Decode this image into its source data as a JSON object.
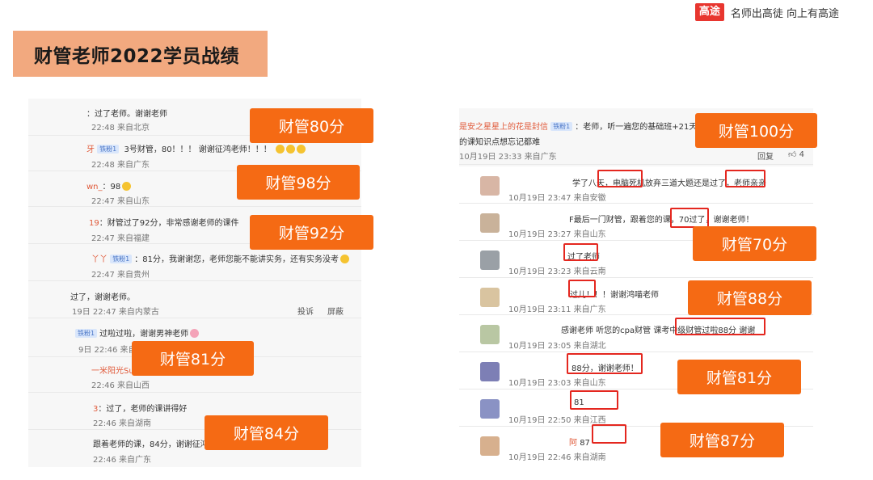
{
  "brand": {
    "logo": "高途",
    "slogan": "名师出高徒 向上有高途"
  },
  "title": "财管老师2022学员战绩",
  "left_comments": [
    {
      "text": "：过了老师。谢谢老师",
      "meta": "22:48 来自北京"
    },
    {
      "name": "牙",
      "badge": "铁粉1",
      "text": "3号财管，80！！！ 谢谢征鸿老师！！！",
      "meta": "22:48 来自广东"
    },
    {
      "name": "wn_",
      "text": "：98",
      "meta": "22:47 来自山东"
    },
    {
      "name": "19",
      "text": "：财管过了92分，非常感谢老师的课件",
      "meta": "22:47 来自福建"
    },
    {
      "name": "丫丫",
      "badge": "铁粉1",
      "text": "：81分，我谢谢您，老师您能不能讲实务，还有实务没考",
      "meta": "22:47 来自贵州"
    },
    {
      "text": "过了，谢谢老师。",
      "meta": "19日 22:47 来自内蒙古",
      "actions": [
        "投诉",
        "屏蔽"
      ]
    },
    {
      "badge": "铁粉1",
      "text": "过啦过啦，谢谢男神老师",
      "meta": "9日 22:46 来自四川"
    },
    {
      "name": "一米阳光Su",
      "text": "",
      "meta": "22:46 来自山西"
    },
    {
      "name": "3",
      "text": "：过了，老师的课讲得好",
      "meta": "22:46 来自湖南"
    },
    {
      "text": "跟着老师的课，84分，谢谢征鸿",
      "meta": "22:46 来自广东"
    }
  ],
  "right_top": {
    "name": "是安之星星上的花是封信",
    "badge": "铁粉1",
    "text": "：老师，听一遍您的基础班+21天",
    "text2": "的课知识点想忘记都难",
    "meta": "10月19日 23:33 来自广东",
    "reply": "回复",
    "likes": "4"
  },
  "right_comments": [
    {
      "text": "学了八天，电脑死机放弃三道大题还是过了，老师亲亲",
      "meta": "10月19日 23:47 来自安徽"
    },
    {
      "text": "F最后一门财管，跟着您的课，70过了，谢谢老师！",
      "meta": "10月19日 23:27 来自山东"
    },
    {
      "text": "过了老师",
      "meta": "10月19日 23:23 来自云南"
    },
    {
      "text": "过儿！！！谢谢鸿喵老师",
      "meta": "10月19日 23:11 来自广东"
    },
    {
      "text": "感谢老师 听您的cpa财管 课考中级财管过啦88分 谢谢",
      "meta": "10月19日 23:05 来自湖北"
    },
    {
      "text": "88分，谢谢老师！",
      "meta": "10月19日 23:03 来自山东"
    },
    {
      "text": "81",
      "meta": "10月19日 22:50 来自江西"
    },
    {
      "name": "阿",
      "text": "87",
      "meta": "10月19日 22:46 来自湖南"
    }
  ],
  "scores_left": [
    "财管80分",
    "财管98分",
    "财管92分",
    "财管81分",
    "财管84分"
  ],
  "scores_right": [
    "财管100分",
    "财管70分",
    "财管88分",
    "财管81分",
    "财管87分"
  ],
  "colors": {
    "accent": "#f56a14",
    "title_bg": "#f2a97f",
    "highlight": "#e4271f",
    "brand": "#e8362f"
  }
}
